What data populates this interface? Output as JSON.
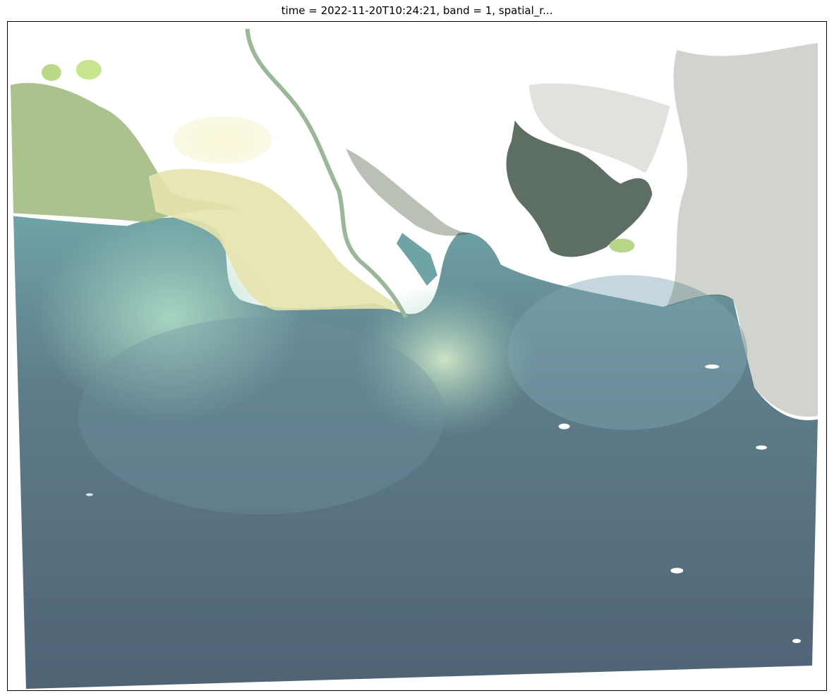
{
  "figure": {
    "title": "time = 2022-11-20T10:24:21, band = 1, spatial_r..."
  },
  "image": {
    "kind": "satellite-true-color-scene",
    "colors": {
      "background": "#ffffff",
      "frame": "#000000",
      "deep_water": "#4f6375",
      "mid_water": "#5f7d8a",
      "turbid_water": "#6fa3a6",
      "sediment_plume": "#a9d8c3",
      "shallow_plume": "#d9efce",
      "land_pale": "#f3f1c4",
      "land_green": "#9cb77a",
      "lagoon_water": "#5d6e63",
      "forest_dark": "#2c3a22"
    }
  }
}
